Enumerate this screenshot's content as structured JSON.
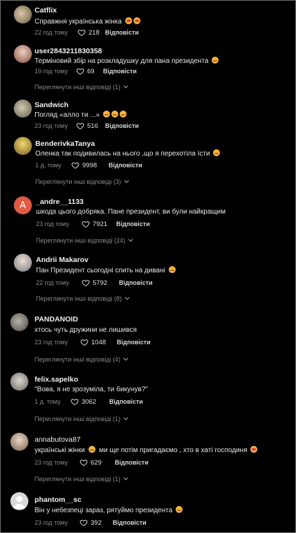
{
  "comments": [
    {
      "user": "Catflix",
      "text": "Справжня українська жінка",
      "emojis": [
        "heart",
        "heart"
      ],
      "time": "22 год тому",
      "likes": "218",
      "reply": "Відповісти",
      "more": ""
    },
    {
      "user": "user2843211830358",
      "text": "Терміновий збір на розкладушку для пана президента",
      "emojis": [
        "tear"
      ],
      "time": "19 год тому",
      "likes": "69",
      "reply": "Відповісти",
      "more": "Переглянути інші відповіді (1)"
    },
    {
      "user": "Sandwich",
      "text": "Погляд «алло ти ...»",
      "emojis": [
        "tear",
        "tear",
        "tear"
      ],
      "time": "23 год тому",
      "likes": "516",
      "reply": "Відповісти",
      "more": ""
    },
    {
      "user": "BenderivkaTanya",
      "text": "Оленка так подивилась на нього ,що я перехотіла їсти",
      "emojis": [
        "tear"
      ],
      "time": "1 д. тому",
      "likes": "9998",
      "reply": "Відповісти",
      "more": "Переглянути інші відповіді (3)"
    },
    {
      "user": "_andre__1133",
      "text": "шкода цього добряка. Пане президент, ви були найкращим",
      "emojis": [],
      "time": "23 год тому",
      "likes": "7921",
      "reply": "Відповісти",
      "more": "Переглянути інші відповіді (24)",
      "avatar_letter": "A"
    },
    {
      "user": "Andrii Makarov",
      "text": "Пан Президент сьогодні спить на дивані",
      "emojis": [
        "tear"
      ],
      "time": "22 год тому",
      "likes": "5792",
      "reply": "Відповісти",
      "more": "Переглянути інші відповіді (8)"
    },
    {
      "user": "PANDANOID",
      "text": "хтось чуть дружини не лишився",
      "emojis": [],
      "time": "23 год тому",
      "likes": "1048",
      "reply": "Відповісти",
      "more": "Переглянути інші відповіді (4)"
    },
    {
      "user": "felix.sapelko",
      "text": "\"Вова, я не зрозуміла, ти бикунув?\"",
      "emojis": [],
      "time": "1 д. тому",
      "likes": "3062",
      "reply": "Відповісти",
      "more": "Переглянути інші відповіді (1)"
    },
    {
      "user": "annabutova87",
      "text": "українські жінки",
      "text2": "ми ще потім пригадаємо , хто в хаті господиня",
      "emojis": [
        "tear"
      ],
      "emojis2": [
        "heart"
      ],
      "time": "23 год тому",
      "likes": "629",
      "reply": "Відповісти",
      "more": "Переглянути інші відповіді (1)"
    },
    {
      "user": "phantom__sc",
      "text": "Він у небезпеці зараз, рятуймо президента",
      "emojis": [
        "tear"
      ],
      "time": "23 год тому",
      "likes": "392",
      "reply": "Відповісти",
      "more": ""
    }
  ],
  "colors": {
    "background": "#000000",
    "muted": "#8a8a8a",
    "text": "#e8e8e8",
    "letter_avatar": "#e05a44"
  }
}
